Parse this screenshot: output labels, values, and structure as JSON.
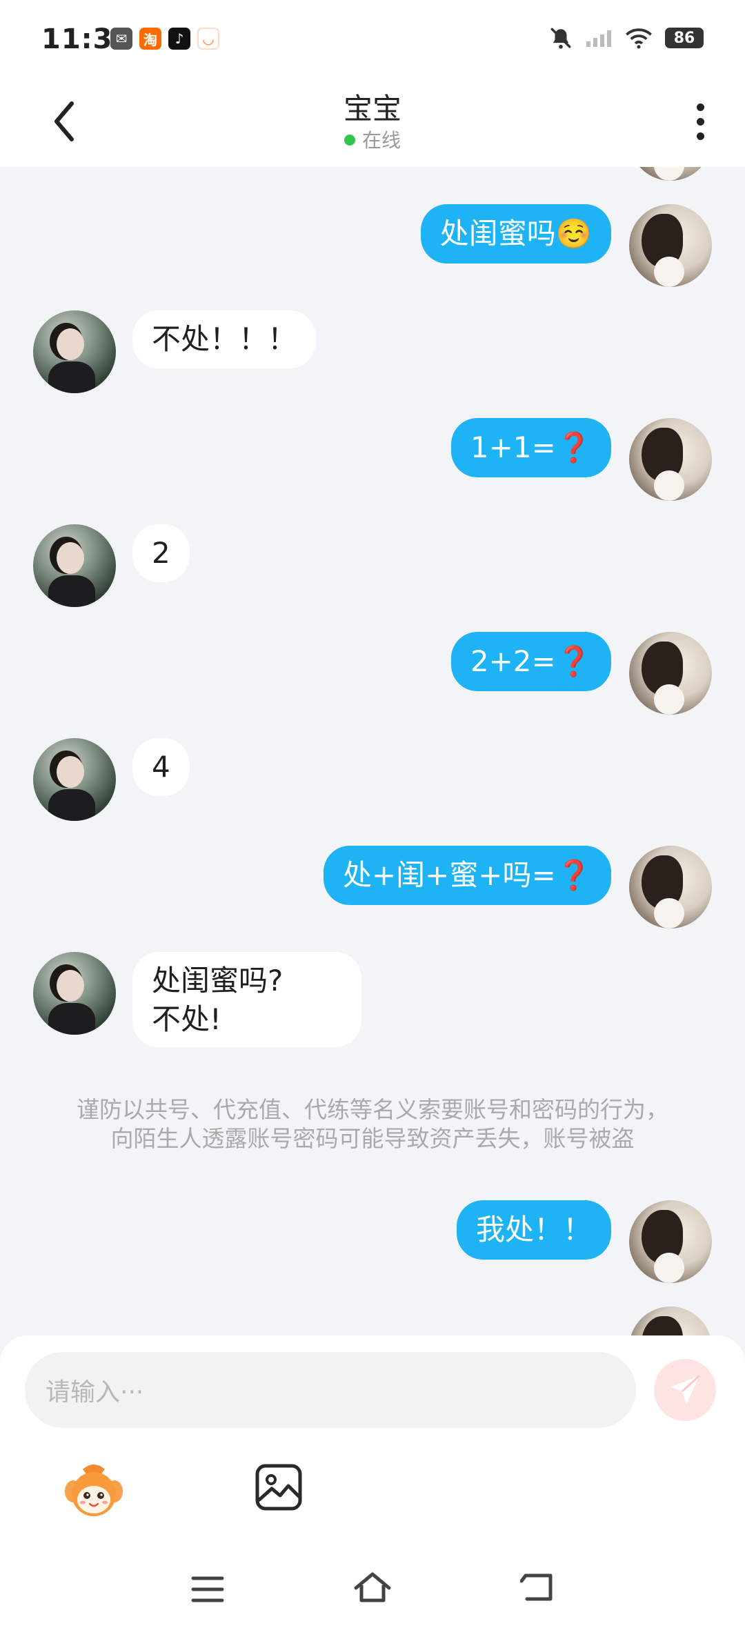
{
  "status_bar": {
    "time": "11:31",
    "apps": [
      {
        "name": "message-app-icon",
        "glyph": "✉",
        "color": "#555555"
      },
      {
        "name": "taobao-app-icon",
        "glyph": "淘",
        "color": "#ff6a00"
      },
      {
        "name": "douyin-app-icon",
        "glyph": "♪",
        "color": "#111111"
      },
      {
        "name": "didi-app-icon",
        "glyph": "◡",
        "color": "#ff7a2e"
      }
    ],
    "battery": "86"
  },
  "header": {
    "title": "宝宝",
    "status": "在线",
    "status_color": "#2fc84a"
  },
  "messages": [
    {
      "from": "self",
      "text": "处闺蜜吗☺️"
    },
    {
      "from": "other",
      "text": "不处！！！"
    },
    {
      "from": "self",
      "text": "1+1=❓"
    },
    {
      "from": "other",
      "text": "2"
    },
    {
      "from": "self",
      "text": "2+2=❓"
    },
    {
      "from": "other",
      "text": "4"
    },
    {
      "from": "self",
      "text": "处+闺+蜜+吗=❓"
    },
    {
      "from": "other",
      "text": "处闺蜜吗?\n不处!"
    },
    {
      "from": "self",
      "text": "我处！！"
    }
  ],
  "warning": {
    "line1": "谨防以共号、代充值、代练等名义索要账号和密码的行为，",
    "line2": "向陌生人透露账号密码可能导致资产丢失，账号被盗"
  },
  "input": {
    "placeholder": "请输入···"
  },
  "colors": {
    "self_bubble": "#1eb3f5",
    "other_bubble": "#ffffff",
    "background": "#f3f4f7",
    "send_button": "#fde3e1"
  }
}
